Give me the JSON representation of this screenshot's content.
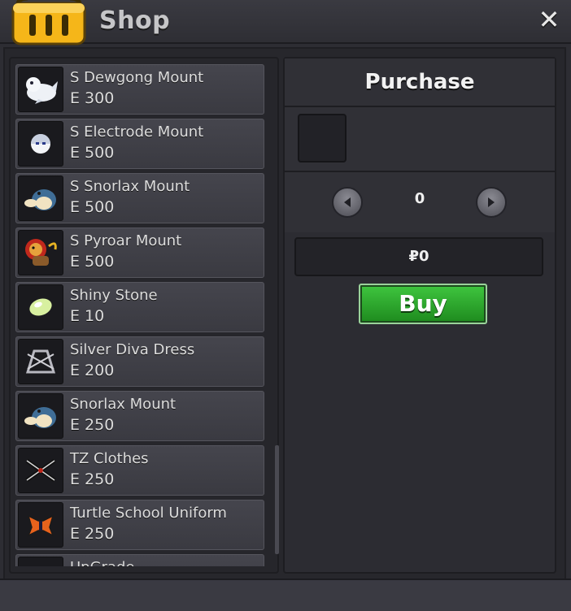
{
  "window": {
    "title": "Shop",
    "close_label": "✕"
  },
  "currency_symbol": "Ε",
  "items": [
    {
      "name": "S Dewgong Mount",
      "price": "300",
      "icon": "dewgong-icon"
    },
    {
      "name": "S Electrode Mount",
      "price": "500",
      "icon": "electrode-icon"
    },
    {
      "name": "S Snorlax Mount",
      "price": "500",
      "icon": "snorlax-icon"
    },
    {
      "name": "S Pyroar Mount",
      "price": "500",
      "icon": "pyroar-icon"
    },
    {
      "name": "Shiny Stone",
      "price": "10",
      "icon": "shiny-stone-icon"
    },
    {
      "name": "Silver Diva Dress",
      "price": "200",
      "icon": "diva-dress-icon"
    },
    {
      "name": "Snorlax Mount",
      "price": "250",
      "icon": "snorlax-icon"
    },
    {
      "name": "TZ Clothes",
      "price": "250",
      "icon": "tz-clothes-icon"
    },
    {
      "name": "Turtle School Uniform",
      "price": "250",
      "icon": "school-uniform-icon"
    },
    {
      "name": "UpGrade",
      "price": "",
      "icon": "upgrade-icon"
    }
  ],
  "purchase": {
    "title": "Purchase",
    "quantity": "0",
    "total_price": "₽0",
    "buy_label": "Buy"
  },
  "colors": {
    "accent": "#2fb02f",
    "panel": "#2c2c32",
    "item_bg": "#404047",
    "title_icon": "#f5b619"
  }
}
